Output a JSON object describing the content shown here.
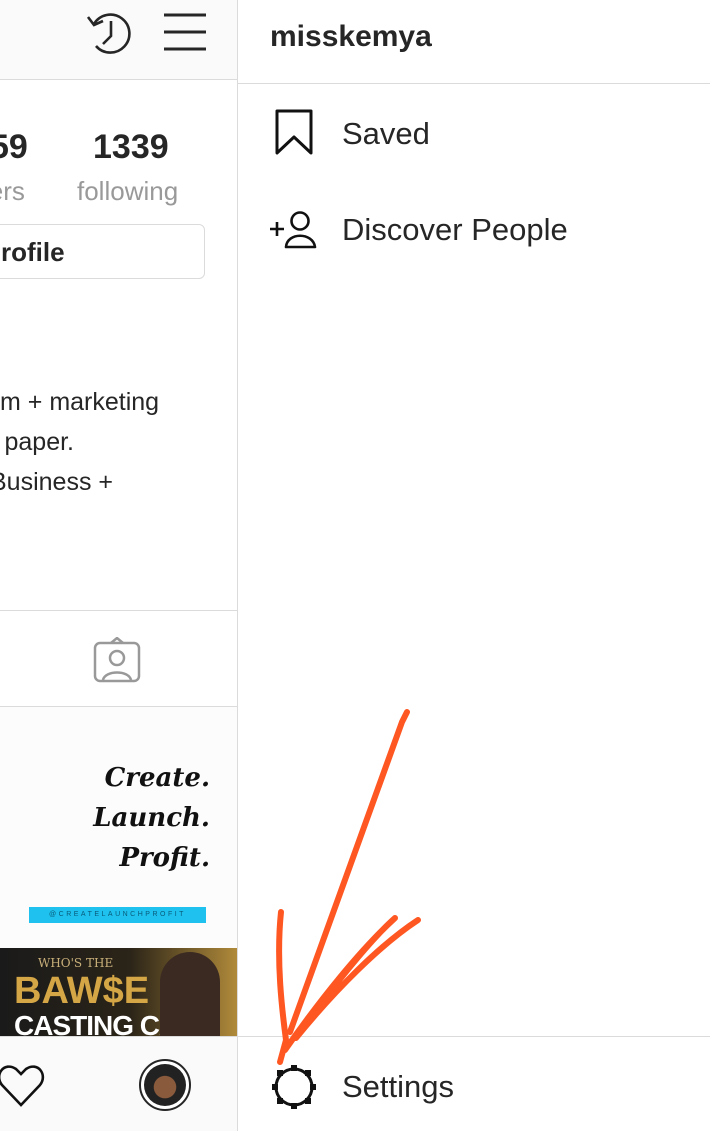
{
  "profile": {
    "followers_count_partial": "59",
    "followers_label_partial": "wers",
    "following_count": "1339",
    "following_label": "following",
    "edit_profile_partial": "rofile",
    "bio_lines": [
      "m + marketing",
      "l paper.",
      "Business +"
    ]
  },
  "posts": [
    {
      "lines": [
        "Create.",
        "Launch.",
        "Profit."
      ],
      "tag": "@CREATELAUNCHPROFIT"
    },
    {
      "lines": [
        "WHO'S THE",
        "BAW$E",
        "CASTING CALL"
      ]
    }
  ],
  "drawer": {
    "username": "misskemya",
    "items": [
      {
        "label": "Saved",
        "icon": "bookmark-icon"
      },
      {
        "label": "Discover People",
        "icon": "add-person-icon"
      }
    ],
    "settings_label": "Settings"
  },
  "colors": {
    "annotation": "#ff5722",
    "tag_bg": "#1fc2ee"
  }
}
